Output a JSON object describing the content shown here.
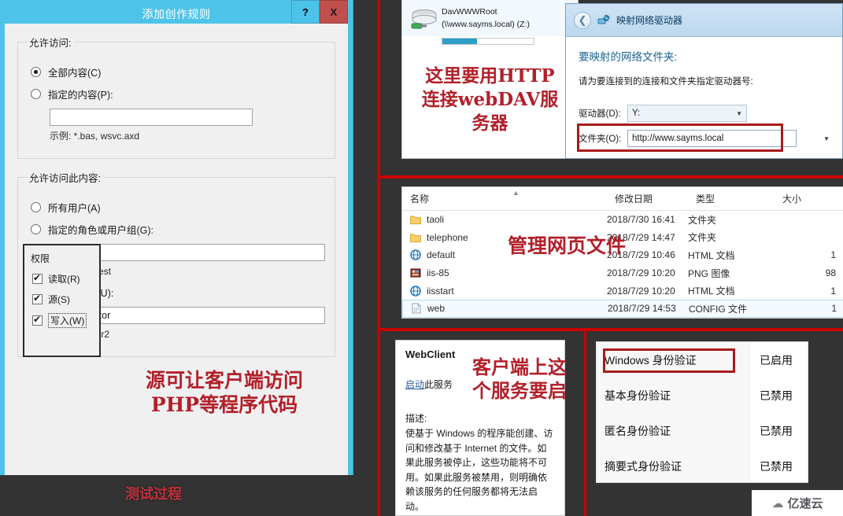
{
  "dialog": {
    "title": "添加创作规则",
    "help_button": "?",
    "close_button": "X",
    "group_allow_access": {
      "legend": "允许访问:",
      "option_all": "全部内容(C)",
      "option_specified": "指定的内容(P):",
      "specified_value": "",
      "example": "示例: *.bas, wsvc.axd"
    },
    "group_allow_who": {
      "legend": "允许访问此内容:",
      "option_all_users": "所有用户(A)",
      "option_roles": "指定的角色或用户组(G):",
      "roles_value": "",
      "roles_hint": "Admin、Guest",
      "option_users": "指定的用户(U):",
      "users_value": "administrator",
      "users_hint": "User1、User2"
    },
    "permissions": {
      "legend": "权限",
      "items": [
        {
          "label": "读取(R)",
          "checked": true,
          "focused": false
        },
        {
          "label": "源(S)",
          "checked": true,
          "focused": false
        },
        {
          "label": "写入(W)",
          "checked": true,
          "focused": true
        }
      ]
    },
    "annotation": "源可让客户端访问\nPHP等程序代码"
  },
  "footer_annotation": "测试过程",
  "map_drive_section": {
    "drive_entry": {
      "name": "DavWWWRoot",
      "path": "(\\\\www.sayms.local) (Z:)"
    },
    "annotation": "这里要用HTTP\n连接webDAV服\n务器",
    "window": {
      "title": "映射网络驱动器",
      "heading": "要映射的网络文件夹:",
      "description": "请为要连接到的连接和文件夹指定驱动器号:",
      "drive_label": "驱动器(D):",
      "drive_value": "Y:",
      "folder_label": "文件夹(O):",
      "folder_value": "http://www.sayms.local"
    }
  },
  "file_list": {
    "annotation": "管理网页文件",
    "columns": [
      "名称",
      "修改日期",
      "类型",
      "大小"
    ],
    "rows": [
      {
        "icon": "folder-icon",
        "name": "taoli",
        "date": "2018/7/30 16:41",
        "type": "文件夹",
        "size": "",
        "selected": false
      },
      {
        "icon": "folder-icon",
        "name": "telephone",
        "date": "2018/7/29 14:47",
        "type": "文件夹",
        "size": "",
        "selected": false
      },
      {
        "icon": "html-icon",
        "name": "default",
        "date": "2018/7/29 10:46",
        "type": "HTML 文档",
        "size": "1",
        "selected": false
      },
      {
        "icon": "png-icon",
        "name": "iis-85",
        "date": "2018/7/29 10:20",
        "type": "PNG 图像",
        "size": "98",
        "selected": false
      },
      {
        "icon": "html-icon",
        "name": "iisstart",
        "date": "2018/7/29 10:20",
        "type": "HTML 文档",
        "size": "1",
        "selected": false
      },
      {
        "icon": "config-icon",
        "name": "web",
        "date": "2018/7/29 14:53",
        "type": "CONFIG 文件",
        "size": "1",
        "selected": true
      }
    ]
  },
  "webclient": {
    "title": "WebClient",
    "action_link": "启动",
    "action_suffix": "此服务",
    "description_label": "描述:",
    "description": "使基于 Windows 的程序能创建、访问和修改基于 Internet 的文件。如果此服务被停止，这些功能将不可用。如果此服务被禁用，则明确依赖该服务的任何服务都将无法启动。",
    "annotation": "客户端上这\n个服务要启"
  },
  "authentication": {
    "rows": [
      {
        "name": "Windows 身份验证",
        "state": "已启用",
        "highlighted": true
      },
      {
        "name": "基本身份验证",
        "state": "已禁用",
        "highlighted": false
      },
      {
        "name": "匿名身份验证",
        "state": "已禁用",
        "highlighted": false
      },
      {
        "name": "摘要式身份验证",
        "state": "已禁用",
        "highlighted": false
      }
    ]
  },
  "watermark": {
    "text": "亿速云",
    "icon": "cloud-icon"
  },
  "colors": {
    "dialog_titlebar": "#4ec3e9",
    "close_button": "#c0504d",
    "annotation_red": "#b2202a",
    "separator_red": "#cc0000",
    "highlight_red": "#a81b1b",
    "link_blue": "#2a5d9e"
  }
}
